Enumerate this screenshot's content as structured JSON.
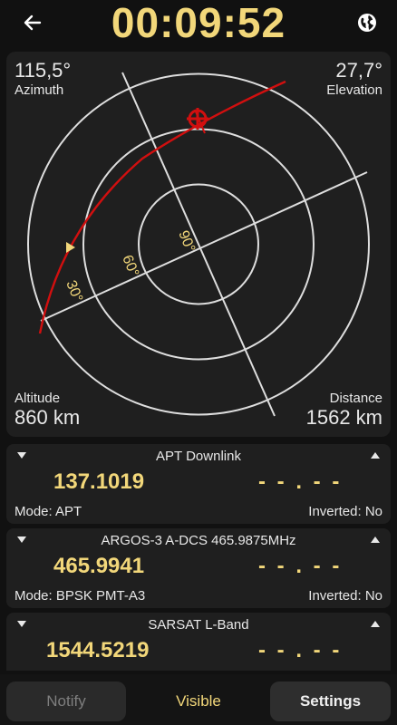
{
  "header": {
    "timer": "00:09:52",
    "back_icon": "arrow-left-icon",
    "globe_icon": "globe-icon"
  },
  "radar": {
    "azimuth_value": "115,5°",
    "azimuth_label": "Azimuth",
    "elevation_value": "27,7°",
    "elevation_label": "Elevation",
    "altitude_label": "Altitude",
    "altitude_value": "860 km",
    "distance_label": "Distance",
    "distance_value": "1562 km",
    "ring_labels": [
      "30°",
      "60°",
      "90°"
    ]
  },
  "colors": {
    "accent": "#f2d77a",
    "track": "#d10f0f",
    "grid": "#dedede",
    "panel": "#1f1f1f"
  },
  "transmitters": [
    {
      "name": "APT Downlink",
      "frequency": "137.1019",
      "frequency_alt": "- - . - -",
      "mode": "Mode: APT",
      "inverted": "Inverted: No"
    },
    {
      "name": "ARGOS-3 A-DCS 465.9875MHz",
      "frequency": "465.9941",
      "frequency_alt": "- - . - -",
      "mode": "Mode: BPSK PMT-A3",
      "inverted": "Inverted: No"
    },
    {
      "name": "SARSAT L-Band",
      "frequency": "1544.5219",
      "frequency_alt": "- - . - -"
    }
  ],
  "bottom": {
    "notify": "Notify",
    "visible": "Visible",
    "settings": "Settings"
  }
}
